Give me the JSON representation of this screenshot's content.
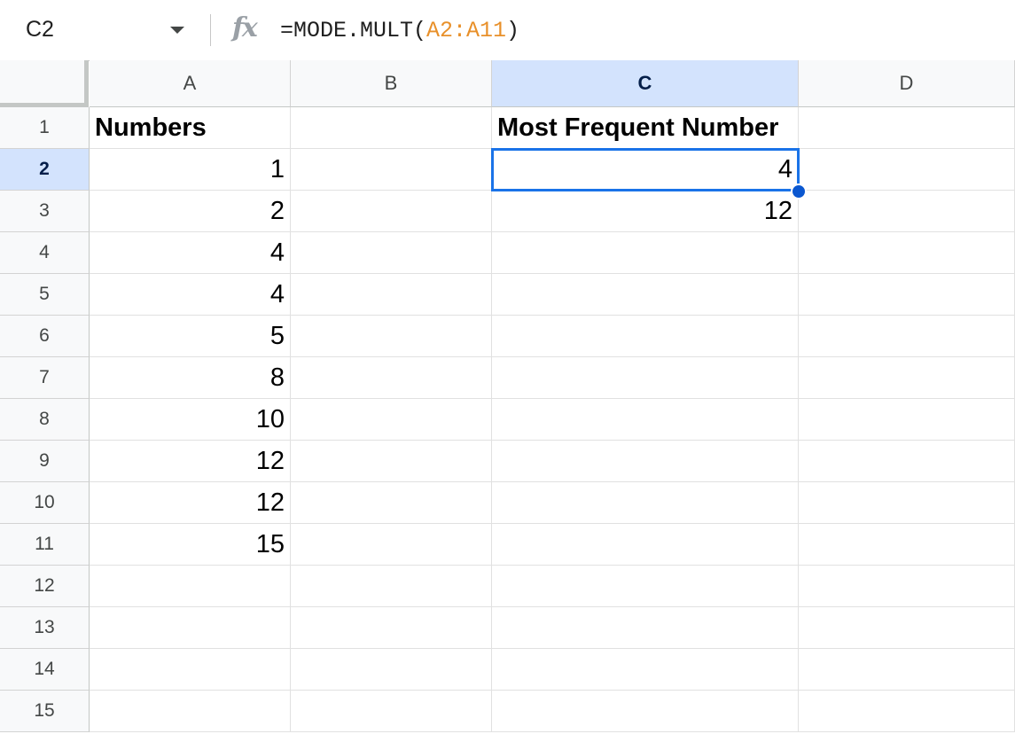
{
  "name_box": "C2",
  "formula": {
    "prefix": "=MODE.MULT(",
    "range": "A2:A11",
    "suffix": ")"
  },
  "columns": [
    "A",
    "B",
    "C",
    "D"
  ],
  "rows": [
    "1",
    "2",
    "3",
    "4",
    "5",
    "6",
    "7",
    "8",
    "9",
    "10",
    "11",
    "12",
    "13",
    "14",
    "15"
  ],
  "active_cell": "C2",
  "cells": {
    "A1": "Numbers",
    "A2": "1",
    "A3": "2",
    "A4": "4",
    "A5": "4",
    "A6": "5",
    "A7": "8",
    "A8": "10",
    "A9": "12",
    "A10": "12",
    "A11": "15",
    "C1": "Most Frequent Number",
    "C2": "4",
    "C3": "12"
  },
  "colors": {
    "selection": "#1a73e8",
    "header_active": "#d3e3fd",
    "formula_range": "#e8902a"
  }
}
